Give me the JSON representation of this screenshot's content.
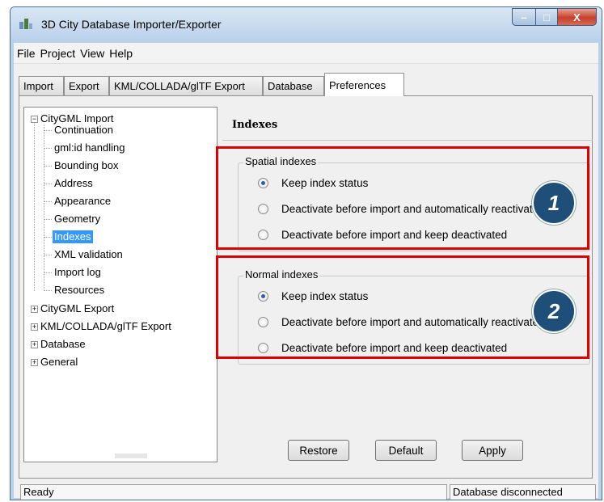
{
  "window": {
    "title": "3D City Database Importer/Exporter",
    "min_glyph": "–",
    "max_glyph": "□",
    "close_glyph": "X"
  },
  "menubar": [
    "File",
    "Project",
    "View",
    "Help"
  ],
  "tabs": [
    "Import",
    "Export",
    "KML/COLLADA/glTF Export",
    "Database",
    "Preferences"
  ],
  "active_tab": "Preferences",
  "tree": {
    "root": "CityGML Import",
    "root_expander": "−",
    "children": [
      "Continuation",
      "gml:id handling",
      "Bounding box",
      "Address",
      "Appearance",
      "Geometry",
      "Indexes",
      "XML validation",
      "Import log",
      "Resources"
    ],
    "selected": "Indexes",
    "collapsed": [
      "CityGML Export",
      "KML/COLLADA/glTF Export",
      "Database",
      "General"
    ],
    "collapsed_expander": "+"
  },
  "panel": {
    "title": "Indexes",
    "spatial": {
      "label": "Spatial indexes",
      "options": [
        "Keep index status",
        "Deactivate before import and automatically reactivate",
        "Deactivate before import and keep deactivated"
      ],
      "selected_index": 0
    },
    "normal": {
      "label": "Normal indexes",
      "options": [
        "Keep index status",
        "Deactivate before import and automatically reactivate",
        "Deactivate before import and keep deactivated"
      ],
      "selected_index": 0
    }
  },
  "annotations": {
    "callout_1": "1",
    "callout_2": "2",
    "highlight_color": "#e00000",
    "callout_color": "#1f4e79"
  },
  "buttons": {
    "restore": "Restore",
    "default": "Default",
    "apply": "Apply"
  },
  "status": {
    "left": "Ready",
    "right": "Database disconnected"
  }
}
